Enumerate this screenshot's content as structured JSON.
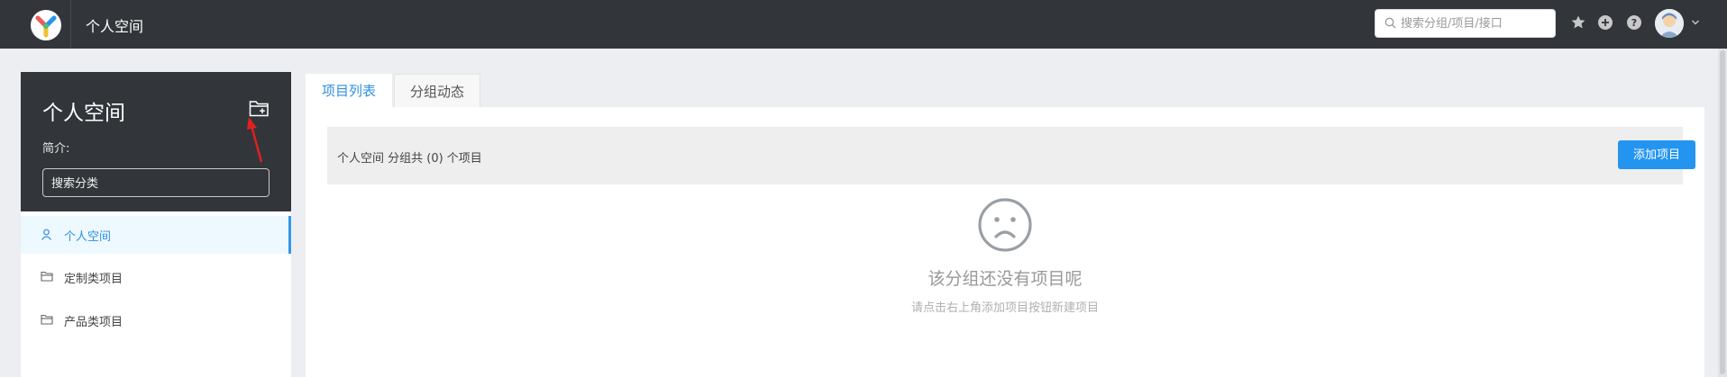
{
  "topbar": {
    "title": "个人空间",
    "search_placeholder": "搜索分组/项目/接口",
    "icons": [
      "star-icon",
      "plus-circle-icon",
      "help-icon"
    ],
    "accent_color": "#32363a"
  },
  "sidebar": {
    "title": "个人空间",
    "description_label": "简介:",
    "search_placeholder": "搜索分类",
    "items": [
      {
        "label": "个人空间",
        "icon": "user-icon",
        "active": true
      },
      {
        "label": "定制类项目",
        "icon": "folder-icon",
        "active": false
      },
      {
        "label": "产品类项目",
        "icon": "folder-icon",
        "active": false
      }
    ]
  },
  "tabs": [
    {
      "label": "项目列表",
      "active": true
    },
    {
      "label": "分组动态",
      "active": false
    }
  ],
  "group_bar": {
    "summary": "个人空间 分组共 (0) 个项目",
    "add_button_label": "添加项目"
  },
  "empty_state": {
    "title": "该分组还没有项目呢",
    "subtitle": "请点击右上角添加项目按钮新建项目"
  },
  "colors": {
    "primary": "#2395f1",
    "header_bg": "#32363a",
    "active_text": "#2f8fe0"
  }
}
